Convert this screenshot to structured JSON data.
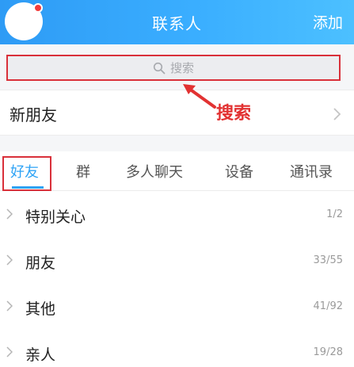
{
  "header": {
    "title": "联系人",
    "add_label": "添加"
  },
  "search": {
    "placeholder": "搜索"
  },
  "new_friend": {
    "label": "新朋友"
  },
  "annotation": {
    "text": "搜索"
  },
  "tabs": [
    {
      "label": "好友",
      "active": true
    },
    {
      "label": "群",
      "active": false
    },
    {
      "label": "多人聊天",
      "active": false
    },
    {
      "label": "设备",
      "active": false
    },
    {
      "label": "通讯录",
      "active": false
    }
  ],
  "groups": [
    {
      "name": "特别关心",
      "count": "1/2"
    },
    {
      "name": "朋友",
      "count": "33/55"
    },
    {
      "name": "其他",
      "count": "41/92"
    },
    {
      "name": "亲人",
      "count": "19/28"
    }
  ],
  "colors": {
    "accent": "#2ea3f5",
    "annotation": "#e23232"
  }
}
